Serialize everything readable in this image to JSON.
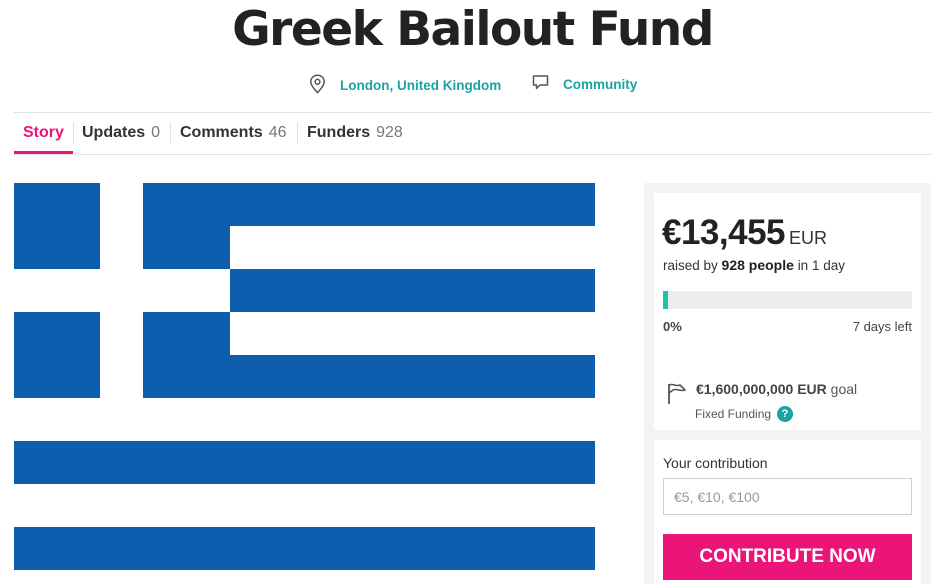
{
  "page": {
    "title": "Greek Bailout Fund"
  },
  "meta": {
    "location": "London, United Kingdom",
    "category": "Community"
  },
  "tabs": [
    {
      "label": "Story",
      "count": ""
    },
    {
      "label": "Updates",
      "count": "0"
    },
    {
      "label": "Comments",
      "count": "46"
    },
    {
      "label": "Funders",
      "count": "928"
    }
  ],
  "campaign": {
    "amount": "€13,455",
    "currency": "EUR",
    "raised_prefix": "raised by",
    "people": "928 people",
    "raised_suffix": "in 1 day",
    "progress_percent": 0,
    "percent_label": "0%",
    "days_left": "7 days left",
    "goal_amount": "€1,600,000,000 EUR",
    "goal_suffix": "goal",
    "funding_type": "Fixed Funding",
    "help_glyph": "?"
  },
  "contribution": {
    "label": "Your contribution",
    "placeholder": "€5, €10, €100",
    "button": "CONTRIBUTE NOW"
  },
  "colors": {
    "accent": "#eb1478",
    "teal": "#1aa3a3",
    "progress": "#1bc5a8",
    "flag_blue": "#0d5eaf"
  },
  "icons": {
    "location": "location-pin-icon",
    "category": "speech-bubble-icon",
    "goal": "flag-icon",
    "help": "help-icon"
  }
}
